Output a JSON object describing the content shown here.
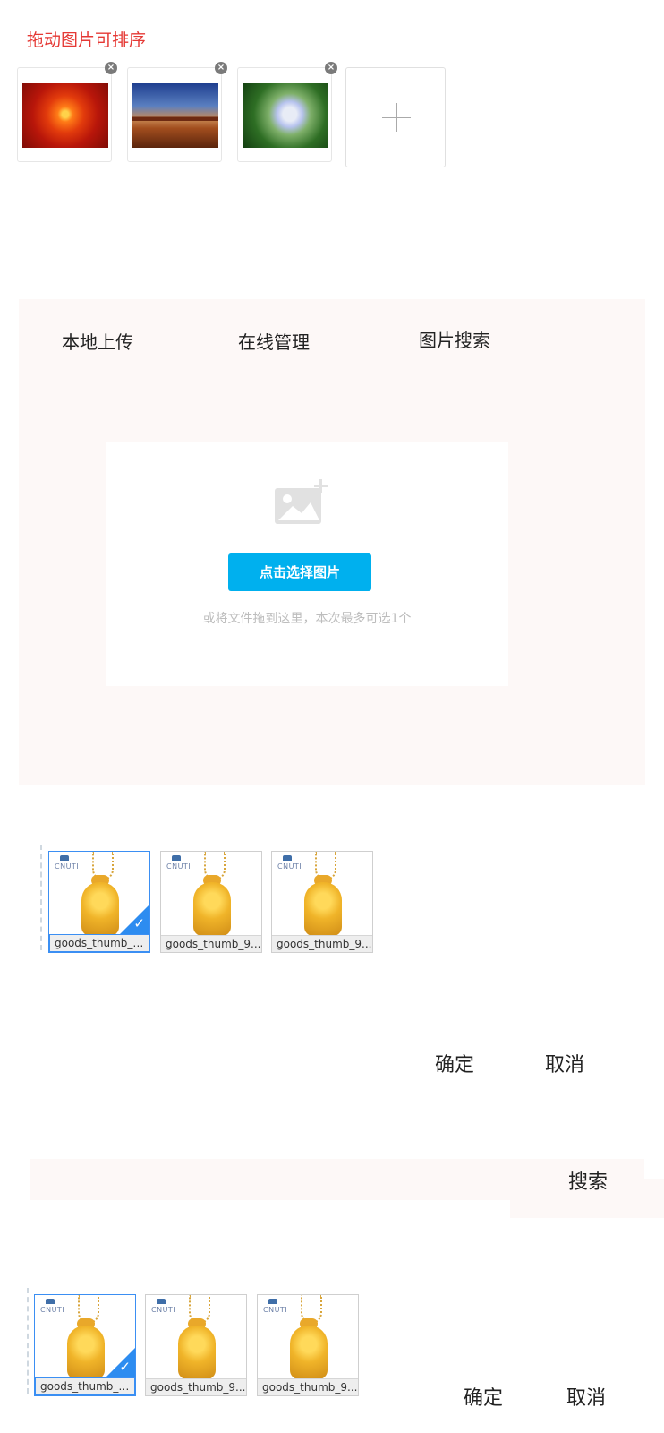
{
  "sortable": {
    "title": "拖动图片可排序",
    "delete_symbol": "×",
    "images": [
      {
        "icon": "flower-image"
      },
      {
        "icon": "desert-image"
      },
      {
        "icon": "hydrangea-image"
      }
    ]
  },
  "uploader": {
    "tabs": [
      {
        "label": "本地上传"
      },
      {
        "label": "在线管理"
      },
      {
        "label": "图片搜索"
      }
    ],
    "choose_button": "点击选择图片",
    "hint": "或将文件拖到这里，本次最多可选1个"
  },
  "online_manage": {
    "items": [
      {
        "caption": "goods_thumb_9...",
        "selected": true,
        "logo": "CNUTI"
      },
      {
        "caption": "goods_thumb_9...",
        "selected": false,
        "logo": "CNUTI"
      },
      {
        "caption": "goods_thumb_9...",
        "selected": false,
        "logo": "CNUTI"
      }
    ],
    "confirm": "确定",
    "cancel": "取消"
  },
  "image_search": {
    "search_button": "搜索",
    "items": [
      {
        "caption": "goods_thumb_9...",
        "selected": true,
        "logo": "CNUTI"
      },
      {
        "caption": "goods_thumb_9...",
        "selected": false,
        "logo": "CNUTI"
      },
      {
        "caption": "goods_thumb_9...",
        "selected": false,
        "logo": "CNUTI"
      }
    ],
    "confirm": "确定",
    "cancel": "取消"
  },
  "colors": {
    "title_red": "#e53935",
    "accent_blue": "#00b0ee",
    "select_blue": "#2d8cf0",
    "panel_bg": "#fdf8f7"
  }
}
